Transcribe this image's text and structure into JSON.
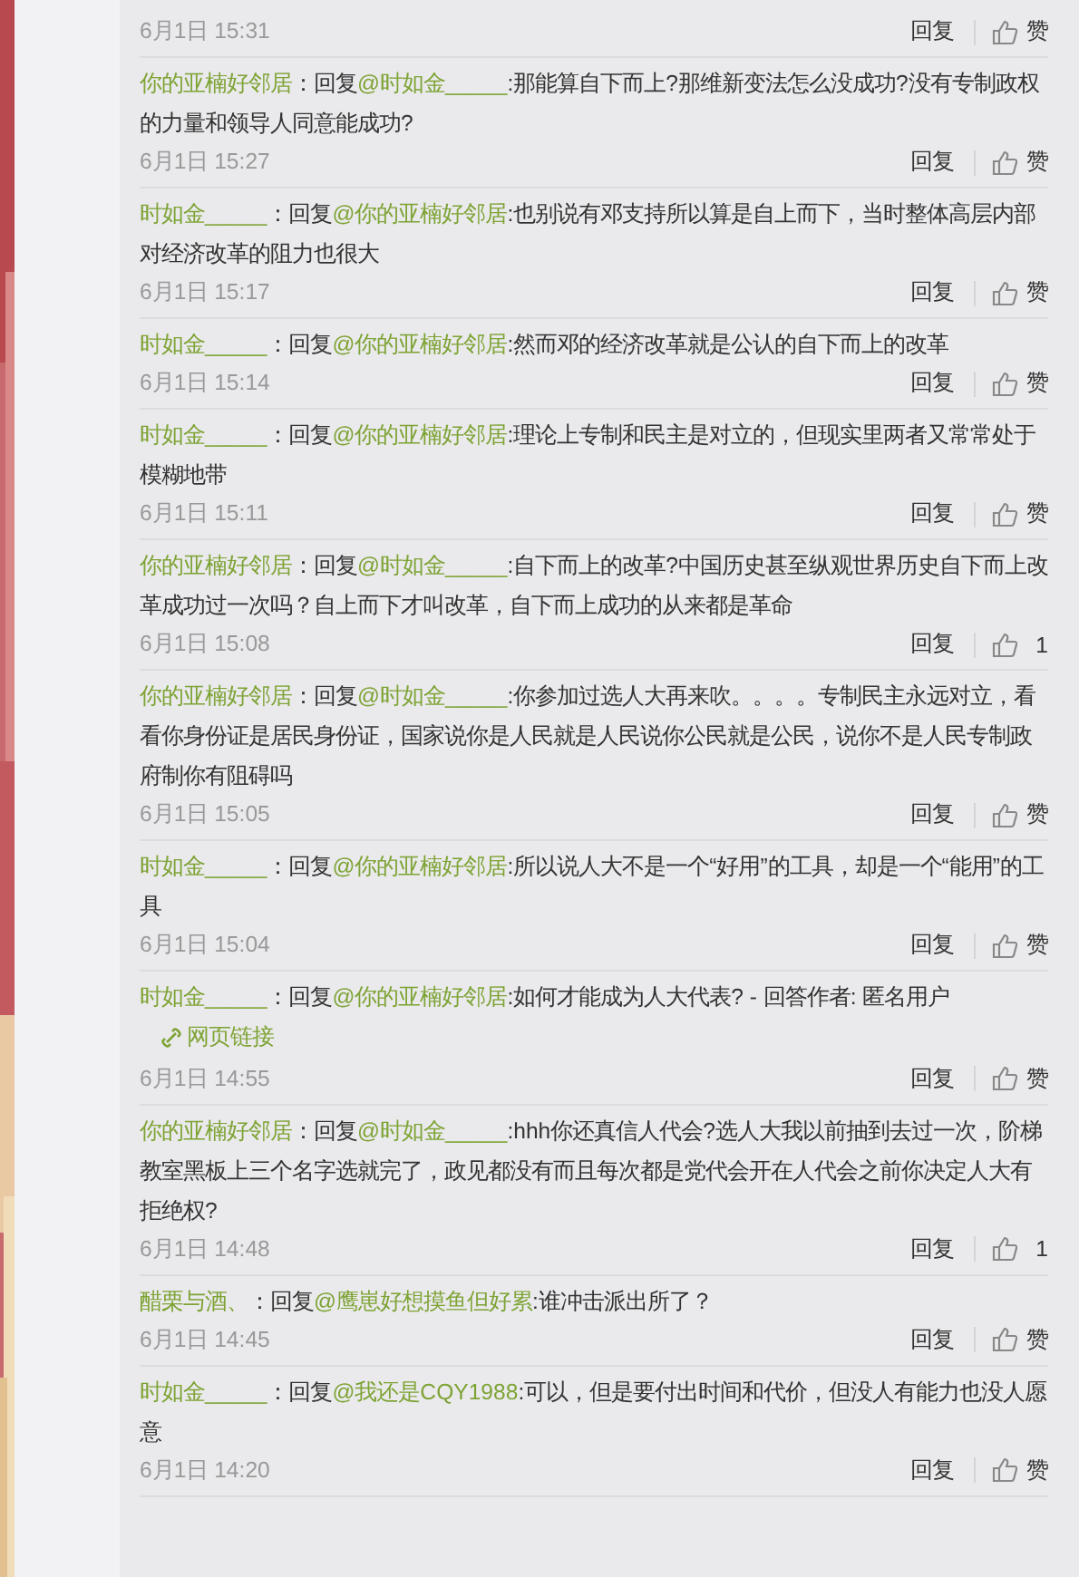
{
  "comments": [
    {
      "time": "6月1日 15:31",
      "reply": "回复",
      "like": "赞"
    },
    {
      "author": "你的亚楠好邻居",
      "reply_label": "：回复",
      "reply_to": "@时如金_____",
      "text": ":那能算自下而上?那维新变法怎么没成功?没有专制政权的力量和领导人同意能成功?",
      "time": "6月1日 15:27",
      "reply": "回复",
      "like": "赞"
    },
    {
      "author": "时如金_____",
      "reply_label": "：回复",
      "reply_to": "@你的亚楠好邻居",
      "text": ":也别说有邓支持所以算是自上而下，当时整体高层内部对经济改革的阻力也很大",
      "time": "6月1日 15:17",
      "reply": "回复",
      "like": "赞"
    },
    {
      "author": "时如金_____",
      "reply_label": "：回复",
      "reply_to": "@你的亚楠好邻居",
      "text": ":然而邓的经济改革就是公认的自下而上的改革",
      "time": "6月1日 15:14",
      "reply": "回复",
      "like": "赞"
    },
    {
      "author": "时如金_____",
      "reply_label": "：回复",
      "reply_to": "@你的亚楠好邻居",
      "text": ":理论上专制和民主是对立的，但现实里两者又常常处于模糊地带",
      "time": "6月1日 15:11",
      "reply": "回复",
      "like": "赞"
    },
    {
      "author": "你的亚楠好邻居",
      "reply_label": "：回复",
      "reply_to": "@时如金_____",
      "text": ":自下而上的改革?中国历史甚至纵观世界历史自下而上改革成功过一次吗？自上而下才叫改革，自下而上成功的从来都是革命",
      "time": "6月1日 15:08",
      "reply": "回复",
      "like": "1"
    },
    {
      "author": "你的亚楠好邻居",
      "reply_label": "：回复",
      "reply_to": "@时如金_____",
      "text": ":你参加过选人大再来吹。。。。专制民主永远对立，看看你身份证是居民身份证，国家说你是人民就是人民说你公民就是公民，说你不是人民专制政府制你有阻碍吗",
      "time": "6月1日 15:05",
      "reply": "回复",
      "like": "赞"
    },
    {
      "author": "时如金_____",
      "reply_label": "：回复",
      "reply_to": "@你的亚楠好邻居",
      "text": ":所以说人大不是一个“好用”的工具，却是一个“能用”的工具",
      "time": "6月1日 15:04",
      "reply": "回复",
      "like": "赞"
    },
    {
      "author": "时如金_____",
      "reply_label": "：回复",
      "reply_to": "@你的亚楠好邻居",
      "text": ":如何才能成为人大代表? - 回答作者: 匿名用户",
      "link": "网页链接",
      "time": "6月1日 14:55",
      "reply": "回复",
      "like": "赞"
    },
    {
      "author": "你的亚楠好邻居",
      "reply_label": "：回复",
      "reply_to": "@时如金_____",
      "text": ":hhh你还真信人代会?选人大我以前抽到去过一次，阶梯教室黑板上三个名字选就完了，政见都没有而且每次都是党代会开在人代会之前你决定人大有拒绝权?",
      "time": "6月1日 14:48",
      "reply": "回复",
      "like": "1"
    },
    {
      "author": "醋栗与酒、",
      "reply_label": "：回复",
      "reply_to": "@鹰崽好想摸鱼但好累",
      "text": ":谁冲击派出所了？",
      "time": "6月1日 14:45",
      "reply": "回复",
      "like": "赞"
    },
    {
      "author": "时如金_____",
      "reply_label": "：回复",
      "reply_to": "@我还是CQY1988",
      "text": ":可以，但是要付出时间和代价，但没人有能力也没人愿意",
      "time": "6月1日 14:20",
      "reply": "回复",
      "like": "赞"
    }
  ]
}
